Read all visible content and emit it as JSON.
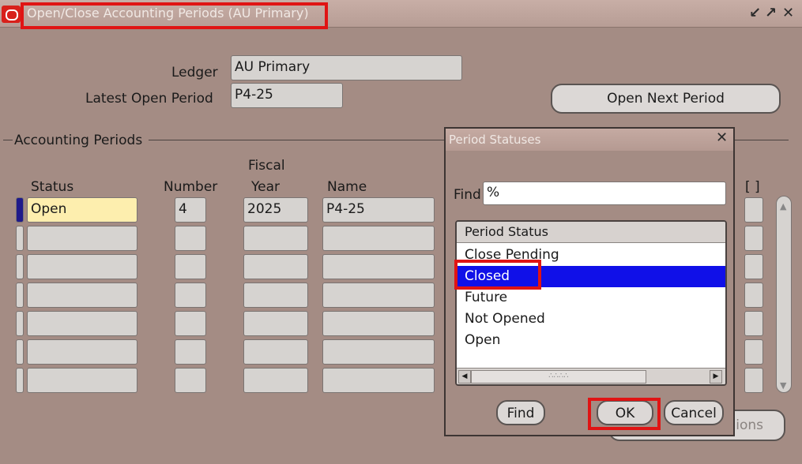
{
  "window": {
    "title": "Open/Close Accounting Periods (AU Primary)",
    "controls": [
      "↙",
      "↗",
      "✕"
    ]
  },
  "form": {
    "ledger_label": "Ledger",
    "ledger_value": "AU Primary",
    "latest_open_label": "Latest Open Period",
    "latest_open_value": "P4-25",
    "open_next_button": "Open Next Period"
  },
  "periods": {
    "section_label": "Accounting Periods",
    "columns": {
      "status": "Status",
      "number": "Number",
      "fiscal_line1": "Fiscal",
      "fiscal_line2": "Year",
      "name": "Name",
      "flex": "[ ]"
    },
    "rows": [
      {
        "status": "Open",
        "number": "4",
        "year": "2025",
        "name": "P4-25"
      },
      {
        "status": "",
        "number": "",
        "year": "",
        "name": ""
      },
      {
        "status": "",
        "number": "",
        "year": "",
        "name": ""
      },
      {
        "status": "",
        "number": "",
        "year": "",
        "name": ""
      },
      {
        "status": "",
        "number": "",
        "year": "",
        "name": ""
      },
      {
        "status": "",
        "number": "",
        "year": "",
        "name": ""
      },
      {
        "status": "",
        "number": "",
        "year": "",
        "name": ""
      }
    ],
    "hidden_button_partial": "ions"
  },
  "dialog": {
    "title": "Period Statuses",
    "find_label": "Find",
    "find_value": "%",
    "list_header": "Period Status",
    "items": [
      "Close Pending",
      "Closed",
      "Future",
      "Not Opened",
      "Open"
    ],
    "selected_index": 1,
    "scroll_grip": "∴∴∴∴",
    "find_button": "Find",
    "ok_button": "OK",
    "cancel_button": "Cancel"
  },
  "colors": {
    "background": "#a48c84",
    "selection": "#1010e8",
    "highlight": "#e01414",
    "active_field": "#fdeeae"
  }
}
